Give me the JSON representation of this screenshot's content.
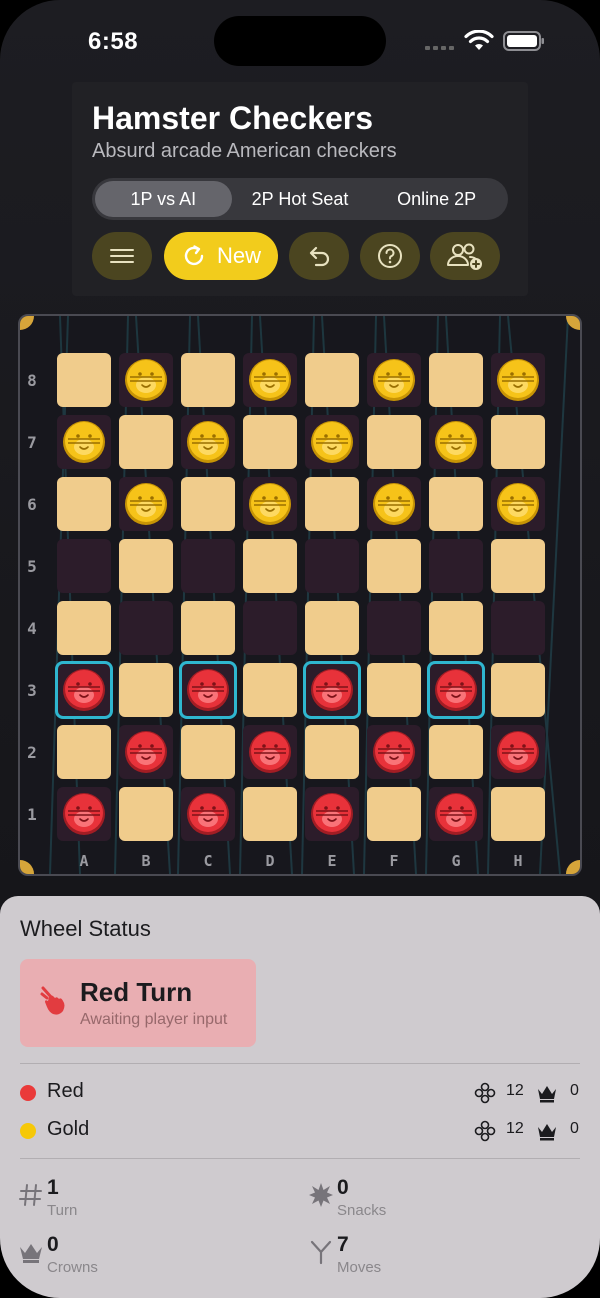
{
  "status_bar": {
    "time": "6:58"
  },
  "header": {
    "title": "Hamster Checkers",
    "subtitle": "Absurd arcade American checkers"
  },
  "modes": {
    "selected": "1P vs AI",
    "options": [
      "1P vs AI",
      "2P Hot Seat",
      "Online 2P"
    ]
  },
  "toolbar": {
    "new_label": "New",
    "icons": [
      "menu-icon",
      "refresh-icon",
      "undo-icon",
      "help-icon",
      "add-people-icon"
    ]
  },
  "board": {
    "ranks": [
      "8",
      "7",
      "6",
      "5",
      "4",
      "3",
      "2",
      "1"
    ],
    "files": [
      "A",
      "B",
      "C",
      "D",
      "E",
      "F",
      "G",
      "H"
    ],
    "rows": [
      [
        ".",
        "G",
        ".",
        "G",
        ".",
        "G",
        ".",
        "G"
      ],
      [
        "G",
        ".",
        "G",
        ".",
        "G",
        ".",
        "G",
        "."
      ],
      [
        ".",
        "G",
        ".",
        "G",
        ".",
        "G",
        ".",
        "G"
      ],
      [
        "-",
        ".",
        "-",
        ".",
        "-",
        ".",
        "-",
        "."
      ],
      [
        ".",
        "-",
        ".",
        "-",
        ".",
        "-",
        ".",
        "-"
      ],
      [
        "R",
        ".",
        "R",
        ".",
        "R",
        ".",
        "R",
        "."
      ],
      [
        ".",
        "R",
        ".",
        "R",
        ".",
        "R",
        ".",
        "R"
      ],
      [
        "R",
        ".",
        "R",
        ".",
        "R",
        ".",
        "R",
        "."
      ]
    ],
    "highlighted": [
      "A3",
      "C3",
      "E3",
      "G3"
    ],
    "colors": {
      "light": "#f0cc8c",
      "dark": "#2c1c2a",
      "red": "#e8323a",
      "gold": "#f6c319",
      "highlight": "#2fb6cf"
    }
  },
  "status": {
    "title": "Wheel Status",
    "turn_title": "Red Turn",
    "turn_subtitle": "Awaiting player input",
    "players": [
      {
        "name": "Red",
        "color": "#ea3a3a",
        "pieces": "12",
        "kings": "0"
      },
      {
        "name": "Gold",
        "color": "#f6c808",
        "pieces": "12",
        "kings": "0"
      }
    ],
    "stats": [
      {
        "value": "1",
        "label": "Turn",
        "icon": "number-sign-icon"
      },
      {
        "value": "0",
        "label": "Snacks",
        "icon": "burst-icon"
      },
      {
        "value": "0",
        "label": "Crowns",
        "icon": "crown-icon"
      },
      {
        "value": "7",
        "label": "Moves",
        "icon": "fork-icon"
      }
    ]
  }
}
